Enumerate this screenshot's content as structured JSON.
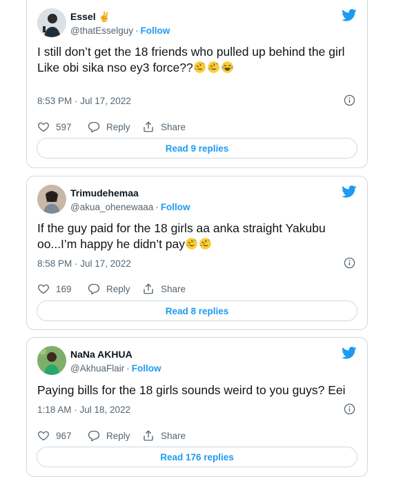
{
  "colors": {
    "accent": "#1d9bf0",
    "muted": "#536471",
    "border": "#cfd9de",
    "text": "#0f1419"
  },
  "tweets": [
    {
      "name": "Essel ✌️",
      "handle": "@thatEsselguy",
      "follow": "Follow",
      "text": "I still don’t get the 18 friends who pulled up behind the girl\nLike obi sika nso ey3 force??",
      "emojis": [
        "rofl-emoji",
        "rofl-emoji",
        "joy-emoji"
      ],
      "time": "8:53 PM · Jul 17, 2022",
      "likes": "597",
      "reply_label": "Reply",
      "share_label": "Share",
      "read_replies": "Read 9 replies"
    },
    {
      "name": "Trimudehemaa",
      "handle": "@akua_ohenewaaa",
      "follow": "Follow",
      "text": "If the guy paid for the 18 girls aa anka straight Yakubu oo...I’m happy he didn’t pay",
      "emojis": [
        "rofl-emoji",
        "rofl-emoji"
      ],
      "time": "8:58 PM · Jul 17, 2022",
      "likes": "169",
      "reply_label": "Reply",
      "share_label": "Share",
      "read_replies": "Read 8 replies"
    },
    {
      "name": "NaNa AKHUA",
      "handle": "@AkhuaFlair",
      "follow": "Follow",
      "text": "Paying bills for the 18 girls sounds weird to you guys? Eei",
      "emojis": [],
      "time": "1:18 AM · Jul 18, 2022",
      "likes": "967",
      "reply_label": "Reply",
      "share_label": "Share",
      "read_replies": "Read 176 replies"
    }
  ]
}
